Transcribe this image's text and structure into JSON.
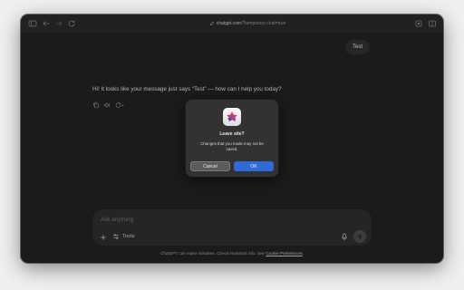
{
  "browser": {
    "url_host": "chatgpt.com",
    "url_path": "/?temporary-chat=true"
  },
  "chat": {
    "user_message": "Test",
    "assistant_message": "Hi! It looks like your message just says “Test” — how can I help you today?"
  },
  "composer": {
    "placeholder": "Ask anything",
    "tools_label": "Tools"
  },
  "disclaimer": {
    "text": "ChatGPT can make mistakes. Check important info. See ",
    "link": "Cookie Preferences",
    "suffix": "."
  },
  "dialog": {
    "title": "Leave site?",
    "message": "Changes that you made may not be saved.",
    "cancel_label": "Cancel",
    "ok_label": "OK"
  },
  "colors": {
    "background": "#212121",
    "bubble": "#303030",
    "primary_button": "#2f6bd6"
  }
}
